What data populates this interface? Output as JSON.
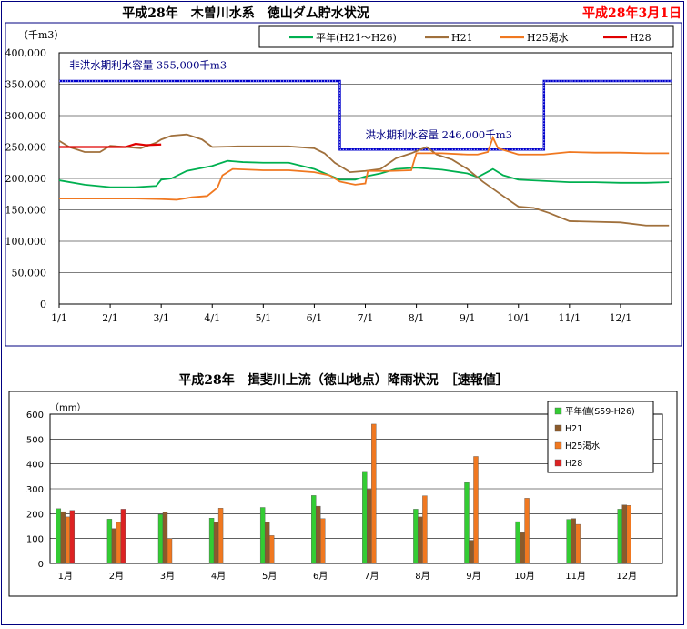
{
  "header": {
    "title": "平成28年　木曽川水系　徳山ダム貯水状況",
    "date": "平成28年3月1日"
  },
  "rain_header": {
    "title": "平成28年　揖斐川上流（徳山地点）降雨状況　［速報値］"
  },
  "colors": {
    "normal": "#00b050",
    "h21": "#a0703c",
    "h25": "#f07820",
    "h28": "#e00000",
    "capacity": "#0000cc",
    "bar_normal": "#33cc33",
    "bar_h21": "#8b5a2b",
    "bar_h25": "#f07820",
    "bar_h28": "#dd2222"
  },
  "chart_data": [
    {
      "type": "line",
      "ylabel": "（千m3）",
      "ylim": [
        0,
        400000
      ],
      "yticks": [
        "0",
        "50,000",
        "100,000",
        "150,000",
        "200,000",
        "250,000",
        "300,000",
        "350,000",
        "400,000"
      ],
      "xlim": [
        1,
        13
      ],
      "xticks": [
        "1/1",
        "2/1",
        "3/1",
        "4/1",
        "5/1",
        "6/1",
        "7/1",
        "8/1",
        "9/1",
        "10/1",
        "11/1",
        "12/1"
      ],
      "grid": true,
      "legend": "top-right",
      "series": [
        {
          "name": "平年(H21～H26)",
          "color_key": "normal",
          "points": [
            [
              1,
              197000
            ],
            [
              1.5,
              190000
            ],
            [
              2,
              186000
            ],
            [
              2.5,
              186000
            ],
            [
              2.9,
              188000
            ],
            [
              3,
              198000
            ],
            [
              3.2,
              200000
            ],
            [
              3.5,
              212000
            ],
            [
              4,
              220000
            ],
            [
              4.3,
              228000
            ],
            [
              4.6,
              226000
            ],
            [
              5,
              225000
            ],
            [
              5.5,
              225000
            ],
            [
              6,
              215000
            ],
            [
              6.3,
              205000
            ],
            [
              6.5,
              198000
            ],
            [
              6.8,
              198000
            ],
            [
              7,
              203000
            ],
            [
              7.3,
              208000
            ],
            [
              7.6,
              215000
            ],
            [
              8,
              217000
            ],
            [
              8.5,
              214000
            ],
            [
              9,
              208000
            ],
            [
              9.2,
              202000
            ],
            [
              9.5,
              215000
            ],
            [
              9.7,
              205000
            ],
            [
              10,
              198000
            ],
            [
              10.5,
              196000
            ],
            [
              11,
              194000
            ],
            [
              11.5,
              194000
            ],
            [
              12,
              193000
            ],
            [
              12.5,
              193000
            ],
            [
              12.95,
              194000
            ]
          ]
        },
        {
          "name": "H21",
          "color_key": "h21",
          "points": [
            [
              1,
              260000
            ],
            [
              1.2,
              250000
            ],
            [
              1.5,
              242000
            ],
            [
              1.8,
              242000
            ],
            [
              2,
              252000
            ],
            [
              2.3,
              250000
            ],
            [
              2.6,
              248000
            ],
            [
              2.9,
              257000
            ],
            [
              3,
              262000
            ],
            [
              3.2,
              268000
            ],
            [
              3.5,
              270000
            ],
            [
              3.8,
              262000
            ],
            [
              4,
              250000
            ],
            [
              4.5,
              251000
            ],
            [
              5,
              251000
            ],
            [
              5.5,
              251000
            ],
            [
              6,
              248000
            ],
            [
              6.2,
              240000
            ],
            [
              6.4,
              225000
            ],
            [
              6.7,
              210000
            ],
            [
              7,
              212000
            ],
            [
              7.3,
              215000
            ],
            [
              7.6,
              232000
            ],
            [
              7.9,
              240000
            ],
            [
              8.2,
              250000
            ],
            [
              8.4,
              238000
            ],
            [
              8.7,
              230000
            ],
            [
              9,
              215000
            ],
            [
              9.3,
              195000
            ],
            [
              9.7,
              172000
            ],
            [
              10,
              155000
            ],
            [
              10.3,
              153000
            ],
            [
              10.6,
              145000
            ],
            [
              11,
              132000
            ],
            [
              11.5,
              131000
            ],
            [
              12,
              130000
            ],
            [
              12.5,
              125000
            ],
            [
              12.95,
              125000
            ]
          ]
        },
        {
          "name": "H25渇水",
          "color_key": "h25",
          "points": [
            [
              1,
              168000
            ],
            [
              1.5,
              168000
            ],
            [
              2,
              168000
            ],
            [
              2.5,
              168000
            ],
            [
              3,
              167000
            ],
            [
              3.3,
              166000
            ],
            [
              3.6,
              170000
            ],
            [
              3.9,
              172000
            ],
            [
              4.1,
              185000
            ],
            [
              4.2,
              205000
            ],
            [
              4.4,
              215000
            ],
            [
              5,
              213000
            ],
            [
              5.5,
              213000
            ],
            [
              6,
              210000
            ],
            [
              6.3,
              205000
            ],
            [
              6.5,
              195000
            ],
            [
              6.8,
              190000
            ],
            [
              7,
              192000
            ],
            [
              7.05,
              212000
            ],
            [
              7.5,
              212000
            ],
            [
              7.9,
              213000
            ],
            [
              8,
              240000
            ],
            [
              8.5,
              240000
            ],
            [
              9,
              238000
            ],
            [
              9.2,
              238000
            ],
            [
              9.4,
              242000
            ],
            [
              9.5,
              265000
            ],
            [
              9.6,
              248000
            ],
            [
              10,
              238000
            ],
            [
              10.5,
              238000
            ],
            [
              11,
              242000
            ],
            [
              11.5,
              241000
            ],
            [
              12,
              241000
            ],
            [
              12.5,
              240000
            ],
            [
              12.95,
              240000
            ]
          ]
        },
        {
          "name": "H28",
          "color_key": "h28",
          "points": [
            [
              1,
              250000
            ],
            [
              1.5,
              250000
            ],
            [
              2,
              250000
            ],
            [
              2.3,
              250000
            ],
            [
              2.5,
              255000
            ],
            [
              2.7,
              253000
            ],
            [
              3,
              254000
            ]
          ]
        }
      ],
      "capacity_line": {
        "points": [
          [
            1,
            355000
          ],
          [
            6.5,
            355000
          ],
          [
            6.5,
            246000
          ],
          [
            10.5,
            246000
          ],
          [
            10.5,
            355000
          ],
          [
            13,
            355000
          ]
        ],
        "annotations": [
          {
            "text": "非洪水期利水容量  355,000千m3",
            "x": 1.2,
            "y": 375000
          },
          {
            "text": "洪水期利水容量  246,000千m3",
            "x": 7.0,
            "y": 264000
          }
        ]
      }
    },
    {
      "type": "bar",
      "ylabel": "（mm）",
      "ylim": [
        0,
        600
      ],
      "yticks": [
        "0",
        "100",
        "200",
        "300",
        "400",
        "500",
        "600"
      ],
      "categories": [
        "1月",
        "2月",
        "3月",
        "4月",
        "5月",
        "6月",
        "7月",
        "8月",
        "9月",
        "10月",
        "11月",
        "12月"
      ],
      "grid": true,
      "legend": "top-right",
      "series": [
        {
          "name": "平年値(S59-H26)",
          "color_key": "bar_normal",
          "values": [
            220,
            178,
            197,
            182,
            225,
            273,
            370,
            218,
            325,
            168,
            177,
            218
          ]
        },
        {
          "name": "H21",
          "color_key": "bar_h21",
          "values": [
            208,
            140,
            207,
            167,
            165,
            230,
            298,
            187,
            93,
            127,
            180,
            235
          ]
        },
        {
          "name": "H25渇水",
          "color_key": "bar_h25",
          "values": [
            187,
            165,
            100,
            222,
            112,
            180,
            560,
            272,
            430,
            262,
            157,
            233
          ]
        },
        {
          "name": "H28",
          "color_key": "bar_h28",
          "values": [
            213,
            218,
            null,
            null,
            null,
            null,
            null,
            null,
            null,
            null,
            null,
            null
          ]
        }
      ]
    }
  ]
}
